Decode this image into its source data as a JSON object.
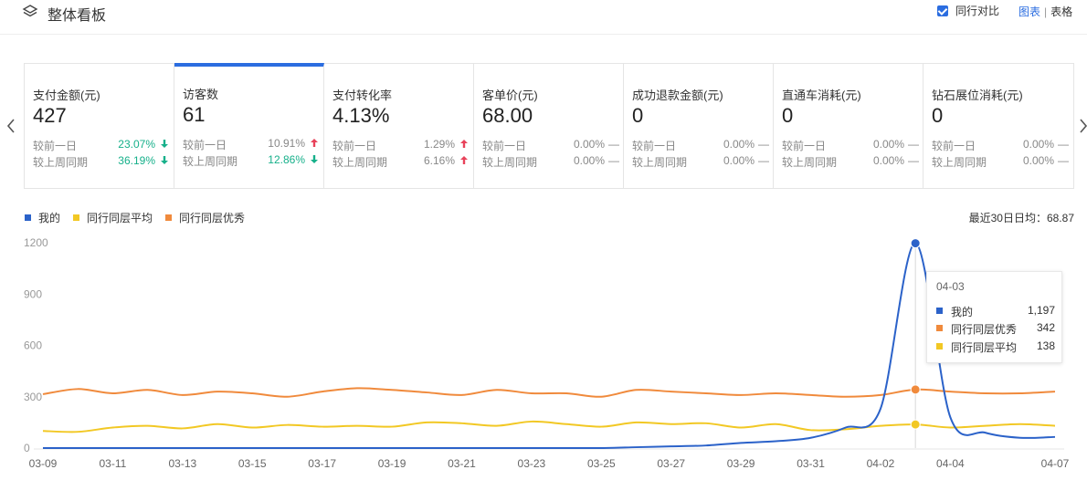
{
  "header": {
    "title": "整体看板",
    "compare_label": "同行对比",
    "compare_checked": true,
    "view_chart": "图表",
    "view_table": "表格"
  },
  "cards": [
    {
      "label": "支付金额(元)",
      "value": "427",
      "r1_label": "较前一日",
      "r1_value": "23.07%",
      "r1_trend": "down",
      "r2_label": "较上周同期",
      "r2_value": "36.19%",
      "r2_trend": "down"
    },
    {
      "label": "访客数",
      "value": "61",
      "r1_label": "较前一日",
      "r1_value": "10.91%",
      "r1_trend": "up",
      "r2_label": "较上周同期",
      "r2_value": "12.86%",
      "r2_trend": "down"
    },
    {
      "label": "支付转化率",
      "value": "4.13%",
      "r1_label": "较前一日",
      "r1_value": "1.29%",
      "r1_trend": "up",
      "r2_label": "较上周同期",
      "r2_value": "6.16%",
      "r2_trend": "up"
    },
    {
      "label": "客单价(元)",
      "value": "68.00",
      "r1_label": "较前一日",
      "r1_value": "0.00%",
      "r1_trend": "flat",
      "r2_label": "较上周同期",
      "r2_value": "0.00%",
      "r2_trend": "flat"
    },
    {
      "label": "成功退款金额(元)",
      "value": "0",
      "r1_label": "较前一日",
      "r1_value": "0.00%",
      "r1_trend": "flat",
      "r2_label": "较上周同期",
      "r2_value": "0.00%",
      "r2_trend": "flat"
    },
    {
      "label": "直通车消耗(元)",
      "value": "0",
      "r1_label": "较前一日",
      "r1_value": "0.00%",
      "r1_trend": "flat",
      "r2_label": "较上周同期",
      "r2_value": "0.00%",
      "r2_trend": "flat"
    },
    {
      "label": "钻石展位消耗(元)",
      "value": "0",
      "r1_label": "较前一日",
      "r1_value": "0.00%",
      "r1_trend": "flat",
      "r2_label": "较上周同期",
      "r2_value": "0.00%",
      "r2_trend": "flat"
    }
  ],
  "active_card": 1,
  "icons": {
    "flat": "—"
  },
  "colors": {
    "accent": "#2b6de0",
    "down": "#16b08a",
    "up": "#e8425a",
    "mine": "#2b62c9",
    "peer_avg": "#f2c824",
    "peer_good": "#f08a3c"
  },
  "legend": [
    "我的",
    "同行同层平均",
    "同行同层优秀"
  ],
  "avg_note": "最近30日日均：68.87",
  "tooltip": {
    "date": "04-03",
    "rows": [
      {
        "name": "我的",
        "value": "1,197",
        "color": "#2b62c9"
      },
      {
        "name": "同行同层优秀",
        "value": "342",
        "color": "#f08a3c"
      },
      {
        "name": "同行同层平均",
        "value": "138",
        "color": "#f2c824"
      }
    ]
  },
  "chart_data": {
    "type": "line",
    "x": [
      "03-09",
      "03-10",
      "03-11",
      "03-12",
      "03-13",
      "03-14",
      "03-15",
      "03-16",
      "03-17",
      "03-18",
      "03-19",
      "03-20",
      "03-21",
      "03-22",
      "03-23",
      "03-24",
      "03-25",
      "03-26",
      "03-27",
      "03-28",
      "03-29",
      "03-30",
      "03-31",
      "04-01",
      "04-02",
      "04-03",
      "04-04",
      "04-05",
      "04-06",
      "04-07"
    ],
    "xticks": [
      "03-09",
      "03-11",
      "03-13",
      "03-15",
      "03-17",
      "03-19",
      "03-21",
      "03-23",
      "03-25",
      "03-27",
      "03-29",
      "03-31",
      "04-02",
      "04-04",
      "04-07"
    ],
    "yticks": [
      0,
      300,
      600,
      900,
      1200
    ],
    "ylim": [
      0,
      1200
    ],
    "grid": false,
    "legend_position": "top-left",
    "series": [
      {
        "name": "我的",
        "color": "#2b62c9",
        "values": [
          0,
          0,
          0,
          0,
          0,
          0,
          0,
          0,
          0,
          0,
          0,
          0,
          0,
          0,
          0,
          0,
          0,
          5,
          10,
          15,
          30,
          40,
          60,
          120,
          230,
          1197,
          180,
          90,
          60,
          65
        ]
      },
      {
        "name": "同行同层平均",
        "color": "#f2c824",
        "values": [
          100,
          95,
          120,
          130,
          115,
          140,
          120,
          135,
          125,
          130,
          125,
          150,
          145,
          130,
          155,
          140,
          125,
          150,
          140,
          145,
          120,
          140,
          105,
          110,
          130,
          138,
          120,
          130,
          140,
          130
        ]
      },
      {
        "name": "同行同层优秀",
        "color": "#f08a3c",
        "values": [
          315,
          345,
          320,
          340,
          310,
          330,
          320,
          300,
          330,
          350,
          340,
          325,
          310,
          340,
          320,
          320,
          300,
          340,
          330,
          320,
          310,
          320,
          310,
          300,
          310,
          342,
          330,
          320,
          320,
          330
        ]
      }
    ],
    "highlight_index": 25
  }
}
